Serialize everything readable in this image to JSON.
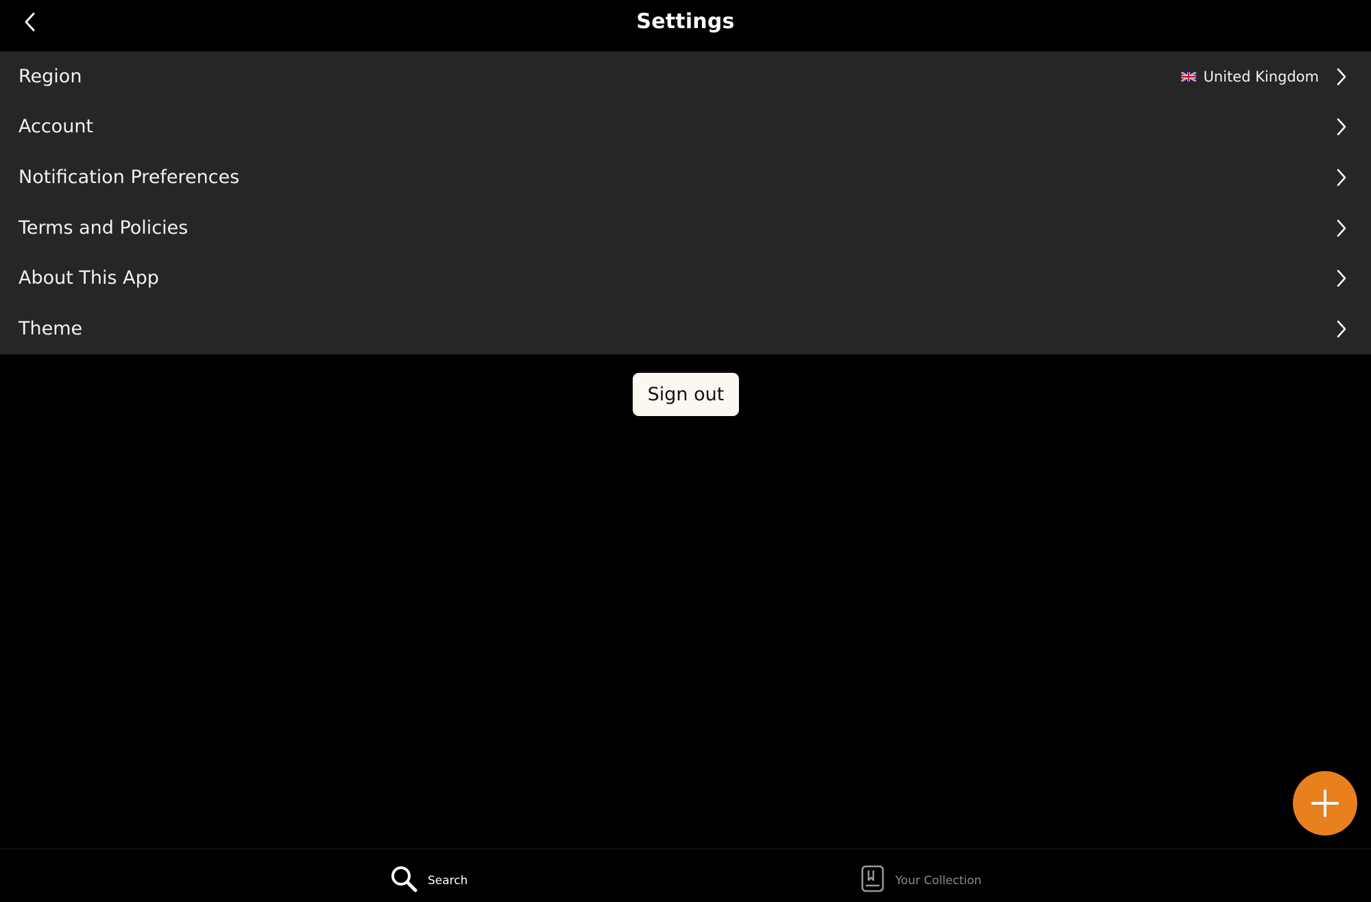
{
  "header": {
    "title": "Settings",
    "back_icon": "chevron-left-icon"
  },
  "settings": {
    "items": [
      {
        "label": "Region",
        "value": "United Kingdom",
        "value_icon": "uk-flag-icon"
      },
      {
        "label": "Account"
      },
      {
        "label": "Notification Preferences"
      },
      {
        "label": "Terms and Policies"
      },
      {
        "label": "About This App"
      },
      {
        "label": "Theme"
      }
    ]
  },
  "sign_out": {
    "label": "Sign out"
  },
  "fab": {
    "icon": "plus-icon",
    "color": "#e8801e"
  },
  "bottom_nav": {
    "items": [
      {
        "label": "Search",
        "icon": "search-icon",
        "active": true
      },
      {
        "label": "Your Collection",
        "icon": "collection-book-icon",
        "active": false
      }
    ]
  },
  "colors": {
    "background": "#000000",
    "list_background": "#262626",
    "accent": "#e8801e",
    "inactive_text": "#8c8c8c"
  }
}
